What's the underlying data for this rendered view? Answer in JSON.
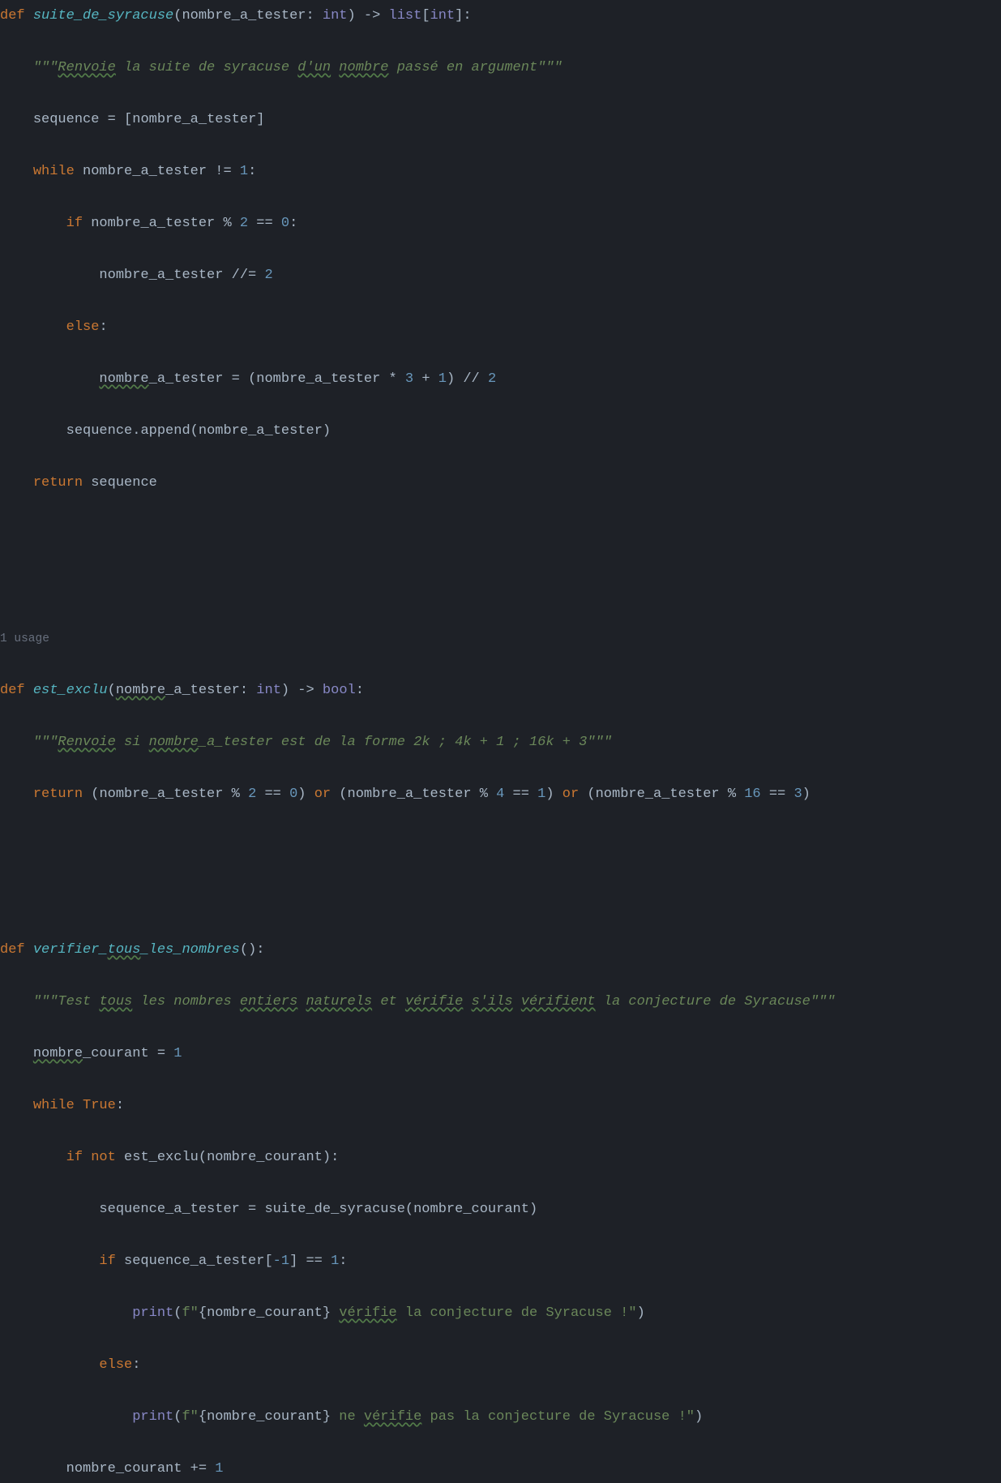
{
  "usage_hint": "1 usage",
  "code": {
    "f1": {
      "name": "suite_de_syracuse",
      "param": "nombre_a_tester",
      "ptype": "int",
      "ret": "list",
      "retinner": "int",
      "doc_a": "Renvoie",
      "doc_b": " la suite de syracuse ",
      "doc_c": "d'un",
      "doc_d": " ",
      "doc_e": "nombre",
      "doc_f": " passé en argument",
      "seq": "sequence",
      "num2a": "2",
      "num0": "0",
      "num2b": "2",
      "num3": "3",
      "num1a": "1",
      "num2c": "2",
      "num1b": "1"
    },
    "f2": {
      "name": "est_exclu",
      "param_wavy": "nombre",
      "param_rest": "_a_tester",
      "ptype": "int",
      "ret": "bool",
      "doc_a": "Renvoie",
      "doc_b": " si ",
      "doc_c": "nombre",
      "doc_d": "_a_tester est de la forme 2k ; 4k + 1 ; 16k + 3",
      "num2": "2",
      "num0": "0",
      "num4": "4",
      "num1": "1",
      "num16": "16",
      "num3": "3"
    },
    "f3": {
      "name_a": "verifier_",
      "name_b": "tous",
      "name_c": "_les_nombres",
      "doc_a": "Test ",
      "doc_b": "tous",
      "doc_c": " les nombres ",
      "doc_d": "entiers",
      "doc_e": " ",
      "doc_f": "naturels",
      "doc_g": " et ",
      "doc_h": "vérifie",
      "doc_i": " ",
      "doc_j": "s'ils",
      "doc_k": " ",
      "doc_l": "vérifient",
      "doc_m": " la conjecture de Syracuse",
      "nombre_wavy": "nombre",
      "nombre_rest": "_courant",
      "num1a": "1",
      "negidx": "-1",
      "num1b": "1",
      "num1c": "1",
      "pr_open": "f\"",
      "pr_close": "\"",
      "msg1a": " ",
      "msg1b": "vérifie",
      "msg1c": " la conjecture de Syracuse !",
      "msg2a": " ne ",
      "msg2b": "vérifie",
      "msg2c": " pas la conjecture de Syracuse !"
    }
  }
}
